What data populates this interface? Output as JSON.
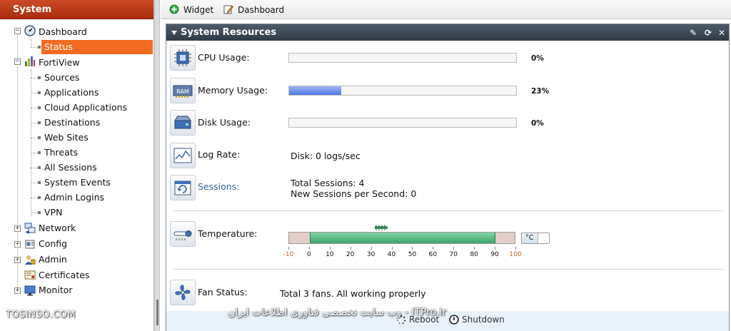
{
  "sidebar": {
    "title": "System",
    "items": [
      {
        "label": "Dashboard",
        "level": 0,
        "expander": "−"
      },
      {
        "label": "Status",
        "level": 1,
        "selected": true
      },
      {
        "label": "FortiView",
        "level": 0,
        "expander": "−"
      },
      {
        "label": "Sources",
        "level": 1
      },
      {
        "label": "Applications",
        "level": 1
      },
      {
        "label": "Cloud Applications",
        "level": 1
      },
      {
        "label": "Destinations",
        "level": 1
      },
      {
        "label": "Web Sites",
        "level": 1
      },
      {
        "label": "Threats",
        "level": 1
      },
      {
        "label": "All Sessions",
        "level": 1
      },
      {
        "label": "System Events",
        "level": 1
      },
      {
        "label": "Admin Logins",
        "level": 1
      },
      {
        "label": "VPN",
        "level": 1
      },
      {
        "label": "Network",
        "level": 0,
        "expander": "+"
      },
      {
        "label": "Config",
        "level": 0,
        "expander": "+"
      },
      {
        "label": "Admin",
        "level": 0,
        "expander": "+"
      },
      {
        "label": "Certificates",
        "level": 0,
        "expander": ""
      },
      {
        "label": "Monitor",
        "level": 0,
        "expander": "+"
      }
    ],
    "watermark": "TOSINSO.COM"
  },
  "toolbar": {
    "widget_label": "Widget",
    "dashboard_label": "Dashboard"
  },
  "panel": {
    "title": "System Resources",
    "cpu": {
      "label": "CPU Usage:",
      "value": 0,
      "value_text": "0%"
    },
    "memory": {
      "label": "Memory Usage:",
      "value": 23,
      "value_text": "23%"
    },
    "disk": {
      "label": "Disk Usage:",
      "value": 0,
      "value_text": "0%"
    },
    "log_rate": {
      "label": "Log Rate:",
      "value_text": "Disk: 0 logs/sec"
    },
    "sessions": {
      "label": "Sessions:",
      "total": "Total Sessions: 4",
      "per_second": "New Sessions per Second: 0"
    },
    "temperature": {
      "label": "Temperature:",
      "unit": "°C",
      "range_low": 0,
      "range_high": 90,
      "scale_labels": [
        "-10",
        "0",
        "10",
        "20",
        "30",
        "40",
        "50",
        "60",
        "70",
        "80",
        "90",
        "100"
      ]
    },
    "fan": {
      "label": "Fan Status:",
      "value_text": "Total 3 fans. All working properly"
    },
    "reboot_label": "Reboot",
    "shutdown_label": "Shutdown",
    "watermark": "ITPro.ir - وب سایت تخصصی فناوری اطلاعات ایران"
  },
  "colors": {
    "sidebar_header": "#b8381a",
    "selected_item": "#f26b21",
    "panel_header": "#3a4construction",
    "memory_bar": "#4e77e4",
    "temperature_ok": "#4fb07a",
    "link": "#34629a"
  }
}
